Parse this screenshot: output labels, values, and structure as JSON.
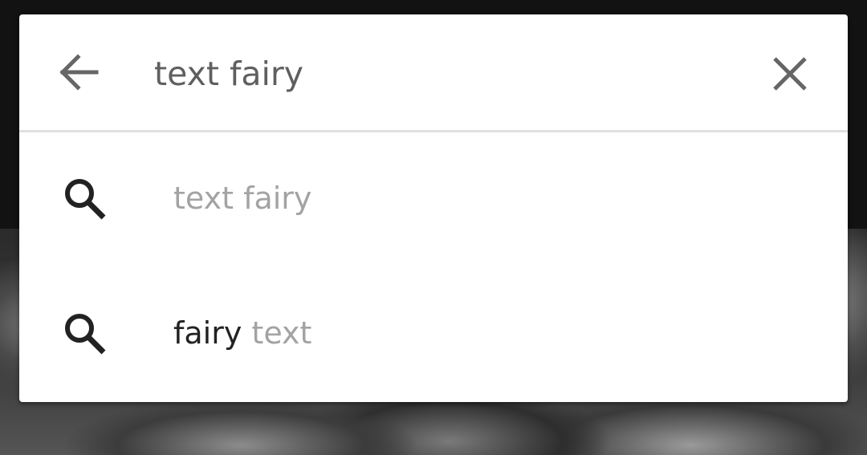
{
  "search": {
    "query": "text fairy"
  },
  "suggestions": [
    {
      "match": "",
      "rest": "text fairy"
    },
    {
      "match": "fairy",
      "rest": " text"
    }
  ],
  "colors": {
    "card_bg": "#ffffff",
    "query_text": "#5f5f5f",
    "suggestion_muted": "#a3a3a3",
    "suggestion_match": "#222222",
    "divider": "#e0e0e0"
  },
  "icons": {
    "back": "arrow-back-icon",
    "clear": "close-icon",
    "suggestion": "search-icon"
  }
}
